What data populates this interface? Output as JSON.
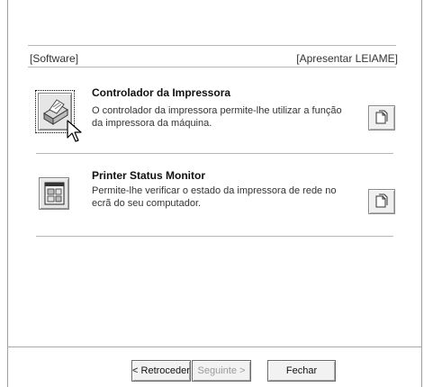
{
  "header": {
    "software_label": "[Software]",
    "readme_link": "[Apresentar LEIAME]"
  },
  "items": [
    {
      "title": "Controlador da Impressora",
      "description": "O controlador da impressora permite-lhe utilizar a função da impressora da máquina.",
      "icon": "printer-driver-icon",
      "doc_icon": "document-icon"
    },
    {
      "title": "Printer Status Monitor",
      "description": "Permite-lhe verificar o estado da impressora de rede no ecrã do seu computador.",
      "icon": "status-monitor-icon",
      "doc_icon": "document-icon"
    }
  ],
  "footer": {
    "back_label": "< Retroceder",
    "next_label": "Seguinte >",
    "close_label": "Fechar"
  }
}
